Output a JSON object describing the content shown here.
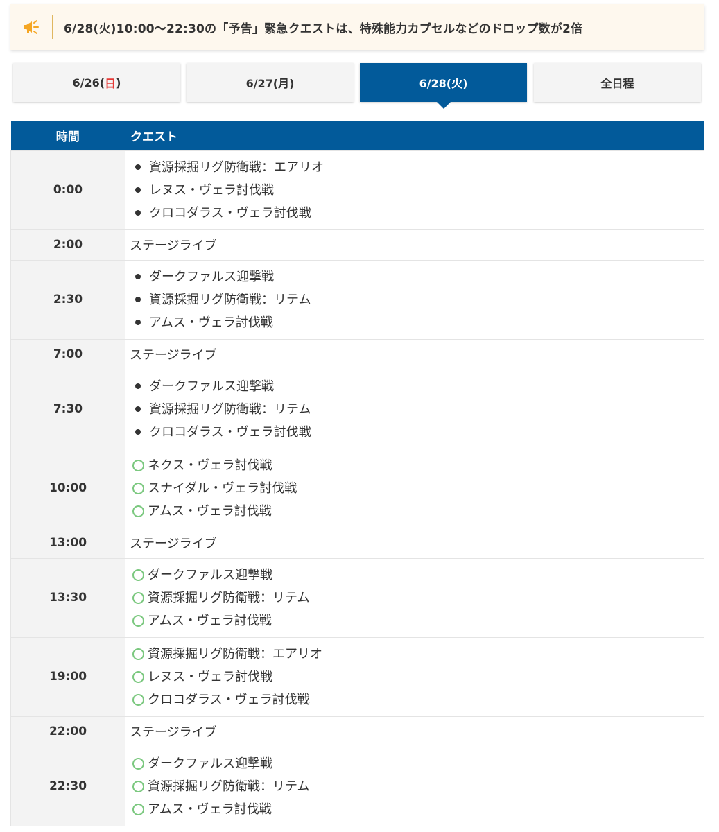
{
  "notice": {
    "icon": "megaphone-icon",
    "text": "6/28(火)10:00～22:30の「予告」緊急クエストは、特殊能力カプセルなどのドロップ数が2倍"
  },
  "tabs": [
    {
      "pre": "6/26(",
      "day": "日",
      "post": ")",
      "active": false
    },
    {
      "pre": "6/27(月)",
      "day": "",
      "post": "",
      "active": false
    },
    {
      "pre": "6/28(火)",
      "day": "",
      "post": "",
      "active": true
    },
    {
      "pre": "全日程",
      "day": "",
      "post": "",
      "active": false
    }
  ],
  "table": {
    "headers": {
      "time": "時間",
      "quest": "クエスト"
    },
    "rows": [
      {
        "time": "0:00",
        "bullet": "dot",
        "quests": [
          "資源採掘リグ防衛戦：エアリオ",
          "レヌス・ヴェラ討伐戦",
          "クロコダラス・ヴェラ討伐戦"
        ]
      },
      {
        "time": "2:00",
        "text": "ステージライブ"
      },
      {
        "time": "2:30",
        "bullet": "dot",
        "quests": [
          "ダークファルス迎撃戦",
          "資源採掘リグ防衛戦：リテム",
          "アムス・ヴェラ討伐戦"
        ]
      },
      {
        "time": "7:00",
        "text": "ステージライブ"
      },
      {
        "time": "7:30",
        "bullet": "dot",
        "quests": [
          "ダークファルス迎撃戦",
          "資源採掘リグ防衛戦：リテム",
          "クロコダラス・ヴェラ討伐戦"
        ]
      },
      {
        "time": "10:00",
        "bullet": "ring",
        "quests": [
          "ネクス・ヴェラ討伐戦",
          "スナイダル・ヴェラ討伐戦",
          "アムス・ヴェラ討伐戦"
        ]
      },
      {
        "time": "13:00",
        "text": "ステージライブ"
      },
      {
        "time": "13:30",
        "bullet": "ring",
        "quests": [
          "ダークファルス迎撃戦",
          "資源採掘リグ防衛戦：リテム",
          "アムス・ヴェラ討伐戦"
        ]
      },
      {
        "time": "19:00",
        "bullet": "ring",
        "quests": [
          "資源採掘リグ防衛戦：エアリオ",
          "レヌス・ヴェラ討伐戦",
          "クロコダラス・ヴェラ討伐戦"
        ]
      },
      {
        "time": "22:00",
        "text": "ステージライブ"
      },
      {
        "time": "22:30",
        "bullet": "ring",
        "quests": [
          "ダークファルス迎撃戦",
          "資源採掘リグ防衛戦：リテム",
          "アムス・ヴェラ討伐戦"
        ]
      }
    ]
  },
  "colors": {
    "accent": "#025a9a",
    "notice_bg": "#fef8ee",
    "ring": "#7bc87f",
    "sunday": "#e53935",
    "megaphone": "#f5a623"
  }
}
